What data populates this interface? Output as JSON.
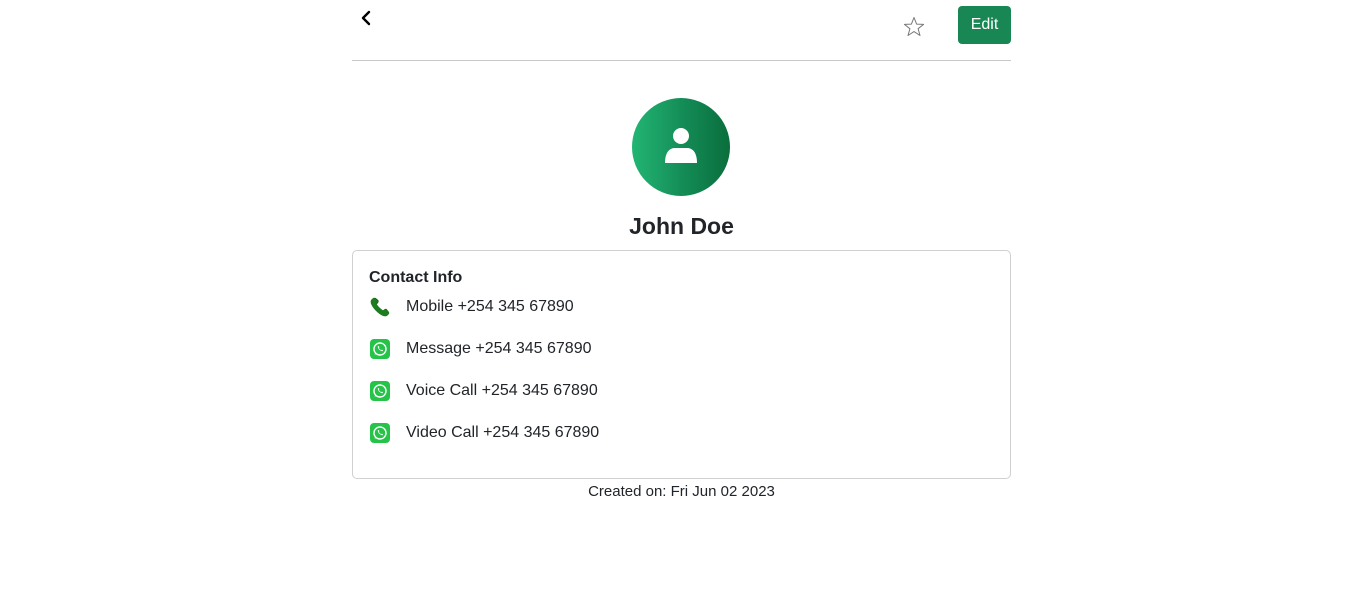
{
  "header": {
    "back_icon": "chevron-left-icon",
    "favorite_icon": "star-outline-icon",
    "edit_label": "Edit"
  },
  "contact": {
    "avatar_icon": "person-icon",
    "name": "John Doe"
  },
  "contact_info": {
    "title": "Contact Info",
    "items": [
      {
        "icon": "phone-icon",
        "label": "Mobile",
        "value": "+254 345 67890",
        "text": "Mobile +254 345 67890"
      },
      {
        "icon": "whatsapp-icon",
        "label": "Message",
        "value": "+254 345 67890",
        "text": "Message +254 345 67890"
      },
      {
        "icon": "whatsapp-icon",
        "label": "Voice Call",
        "value": "+254 345 67890",
        "text": "Voice Call +254 345 67890"
      },
      {
        "icon": "whatsapp-icon",
        "label": "Video Call",
        "value": "+254 345 67890",
        "text": "Video Call +254 345 67890"
      }
    ]
  },
  "footer": {
    "created_text": "Created on: Fri Jun 02 2023"
  },
  "colors": {
    "primary_green": "#198754",
    "whatsapp_green": "#25d366",
    "phone_green": "#1e7b1e",
    "border": "#d0d0d0"
  }
}
